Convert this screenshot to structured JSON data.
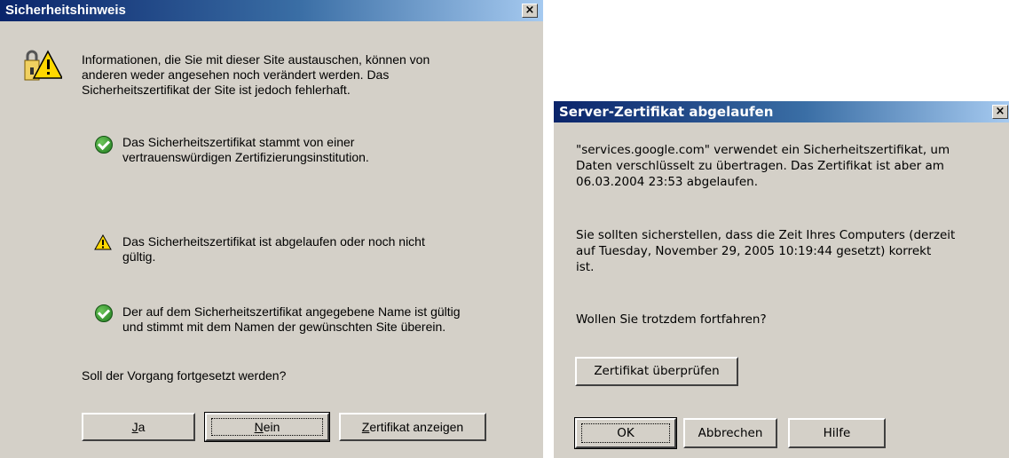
{
  "dialog1": {
    "title": "Sicherheitshinweis",
    "close_glyph": "×",
    "intro_lines": [
      "Informationen, die Sie mit dieser Site austauschen, können von",
      "anderen weder angesehen noch verändert werden. Das",
      "Sicherheitszertifikat der Site ist jedoch fehlerhaft."
    ],
    "checks": [
      {
        "icon": "green-check-icon",
        "lines": [
          "Das Sicherheitszertifikat stammt von einer",
          "vertrauenswürdigen Zertifizierungsinstitution."
        ]
      },
      {
        "icon": "warning-triangle-icon",
        "lines": [
          "Das Sicherheitszertifikat ist abgelaufen oder noch nicht",
          "gültig."
        ]
      },
      {
        "icon": "green-check-icon",
        "lines": [
          "Der auf dem Sicherheitszertifikat angegebene Name ist gültig",
          "und stimmt mit dem Namen der gewünschten Site überein."
        ]
      }
    ],
    "question": "Soll der Vorgang fortgesetzt werden?",
    "buttons": {
      "yes_first": "J",
      "yes_rest": "a",
      "no_first": "N",
      "no_rest": "ein",
      "cert_first": "Z",
      "cert_rest": "ertifikat anzeigen"
    },
    "main_icon": "security-lock-warning-icon"
  },
  "dialog2": {
    "title": "Server-Zertifikat abgelaufen",
    "close_glyph": "×",
    "para1_lines": [
      "\"services.google.com\" verwendet ein Sicherheitszertifikat, um",
      "Daten verschlüsselt zu übertragen. Das Zertifikat ist aber am",
      "06.03.2004 23:53 abgelaufen."
    ],
    "para2_lines": [
      "Sie sollten sicherstellen, dass die Zeit Ihres Computers (derzeit",
      "auf Tuesday, November 29, 2005 10:19:44 gesetzt) korrekt",
      "ist."
    ],
    "question": "Wollen Sie trotzdem fortfahren?",
    "buttons": {
      "check_cert": "Zertifikat überprüfen",
      "ok": "OK",
      "cancel": "Abbrechen",
      "help": "Hilfe"
    }
  }
}
